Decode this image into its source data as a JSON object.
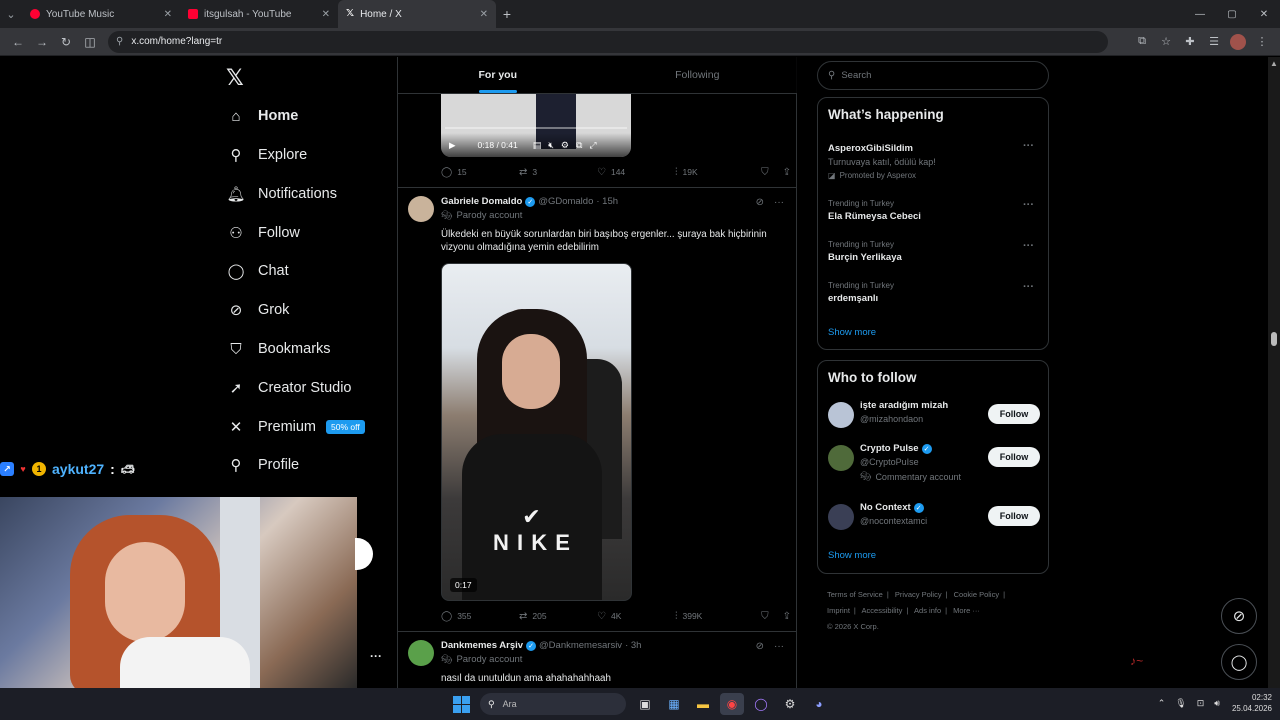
{
  "browser": {
    "tabs": [
      {
        "title": "YouTube Music",
        "color": "#ff0033"
      },
      {
        "title": "itsgulsah - YouTube",
        "color": "#ff0033"
      },
      {
        "title": "Home / X",
        "color": "#ffffff"
      }
    ],
    "url": "x.com/home?lang=tr"
  },
  "nav": {
    "items": [
      {
        "label": "Home",
        "icon": "home-icon"
      },
      {
        "label": "Explore",
        "icon": "search-icon"
      },
      {
        "label": "Notifications",
        "icon": "bell-icon"
      },
      {
        "label": "Follow",
        "icon": "person-plus-icon"
      },
      {
        "label": "Chat",
        "icon": "chat-bubble-icon"
      },
      {
        "label": "Grok",
        "icon": "grok-icon"
      },
      {
        "label": "Bookmarks",
        "icon": "bookmark-icon"
      },
      {
        "label": "Creator Studio",
        "icon": "rocket-icon"
      },
      {
        "label": "Premium",
        "icon": "x-logo-icon"
      },
      {
        "label": "Profile",
        "icon": "person-icon"
      }
    ],
    "premium_badge": "50% off"
  },
  "overlay": {
    "chat_user": "aykut27",
    "chat_sep": ":"
  },
  "timeline": {
    "tabs": [
      "For you",
      "Following"
    ],
    "post0": {
      "video_time": "0:18 / 0:41",
      "replies": "15",
      "reposts": "3",
      "likes": "144",
      "views": "19K"
    },
    "post1": {
      "name": "Gabriele Domaldo",
      "handle": "@GDomaldo",
      "time": "· 15h",
      "label": "Parody account",
      "text": "Ülkedeki en büyük sorunlardan biri başıboş ergenler... şuraya bak hiçbirinin vizyonu olmadığına yemin edebilirim",
      "video_duration": "0:17",
      "replies": "355",
      "reposts": "205",
      "likes": "4K",
      "views": "399K"
    },
    "post2": {
      "name": "Dankmemes Arşiv",
      "handle": "@Dankmemesarsiv",
      "time": "· 3h",
      "label": "Parody account",
      "text": "nasıl da unutuldun ama ahahahahhaah"
    }
  },
  "sidebar": {
    "search_placeholder": "Search",
    "happening_title": "What’s happening",
    "trends": [
      {
        "context": "",
        "name": "AsperoxGibiSildim",
        "desc": "Turnuvaya katıl, ödülü kap!",
        "promo": "Promoted by Asperox"
      },
      {
        "context": "Trending in Turkey",
        "name": "Ela Rümeysa Cebeci"
      },
      {
        "context": "Trending in Turkey",
        "name": "Burçin Yerlikaya"
      },
      {
        "context": "Trending in Turkey",
        "name": "erdemşanlı"
      }
    ],
    "show_more": "Show more",
    "who_title": "Who to follow",
    "who": [
      {
        "name": "işte aradığım mizah",
        "handle": "@mizahondaon",
        "note": ""
      },
      {
        "name": "Crypto Pulse",
        "handle": "@CryptoPuIse",
        "note": "Commentary account"
      },
      {
        "name": "No Context",
        "handle": "@nocontextamci",
        "note": ""
      }
    ],
    "follow_label": "Follow",
    "footer": [
      "Terms of Service",
      "Privacy Policy",
      "Cookie Policy",
      "Imprint",
      "Accessibility",
      "Ads info",
      "More ···",
      "© 2026 X Corp."
    ]
  },
  "taskbar": {
    "search_placeholder": "Ara",
    "time": "02:32",
    "date": "25.04.2026"
  }
}
